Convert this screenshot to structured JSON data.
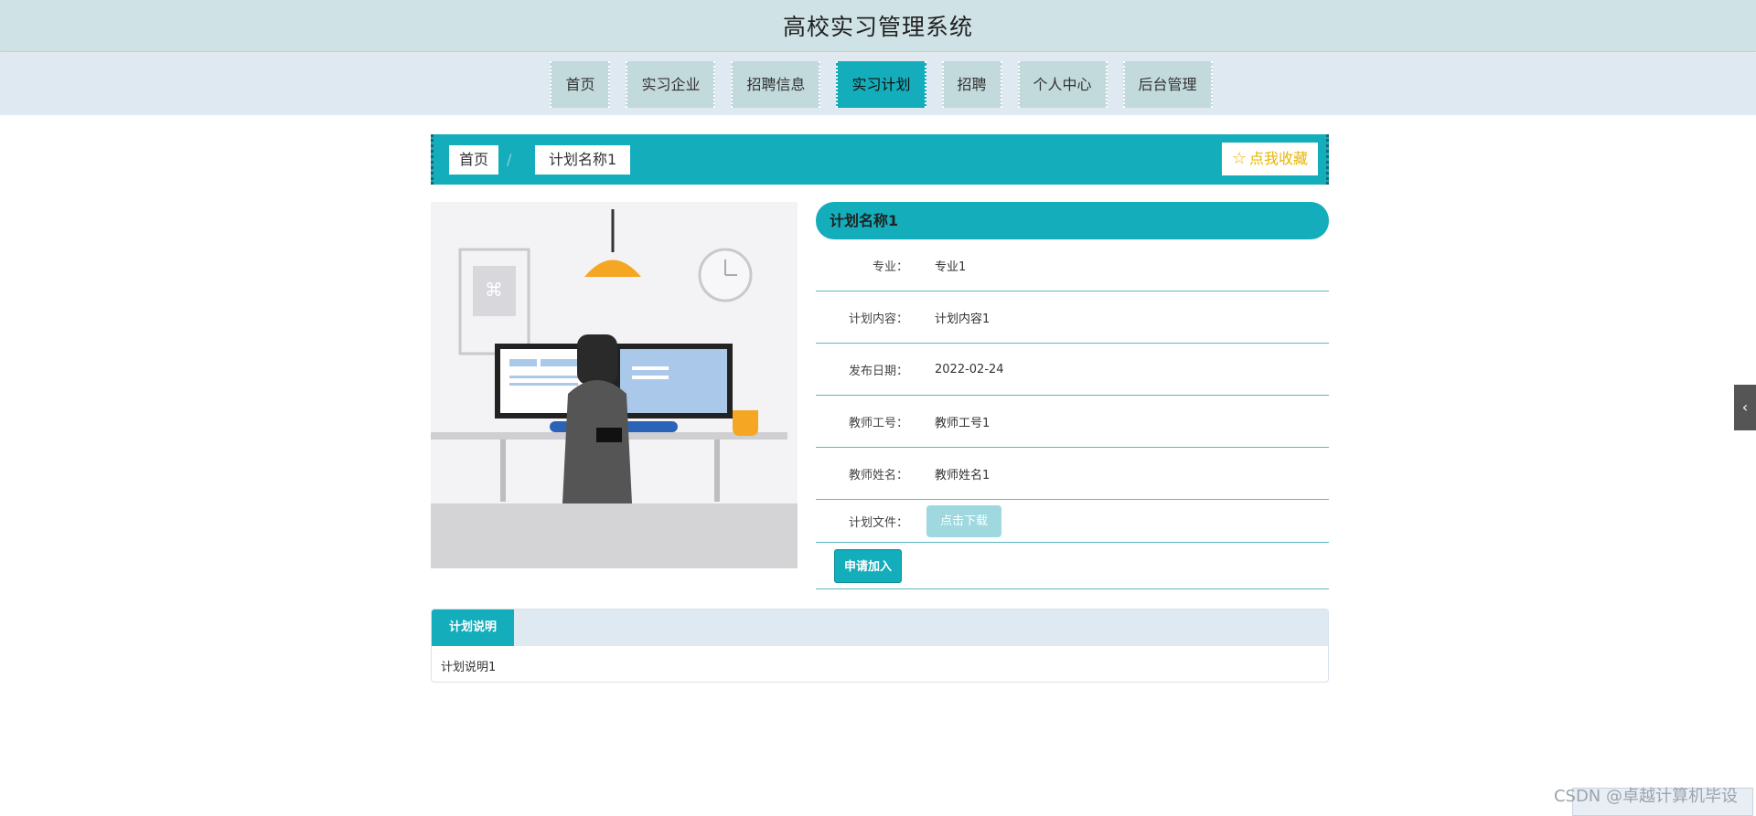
{
  "header": {
    "title": "高校实习管理系统"
  },
  "nav": {
    "items": [
      {
        "label": "首页",
        "active": false
      },
      {
        "label": "实习企业",
        "active": false
      },
      {
        "label": "招聘信息",
        "active": false
      },
      {
        "label": "实习计划",
        "active": true
      },
      {
        "label": "招聘",
        "active": false
      },
      {
        "label": "个人中心",
        "active": false
      },
      {
        "label": "后台管理",
        "active": false
      }
    ]
  },
  "breadcrumb": {
    "home": "首页",
    "separator": "/",
    "current": "计划名称1",
    "favorite_label": "点我收藏",
    "favorite_icon": "star-icon"
  },
  "detail": {
    "title": "计划名称1",
    "fields": [
      {
        "label": "专业：",
        "value": "专业1"
      },
      {
        "label": "计划内容：",
        "value": "计划内容1"
      },
      {
        "label": "发布日期：",
        "value": "2022-02-24"
      },
      {
        "label": "教师工号：",
        "value": "教师工号1"
      },
      {
        "label": "教师姓名：",
        "value": "教师姓名1"
      }
    ],
    "file_label": "计划文件：",
    "download_label": "点击下载",
    "apply_label": "申请加入"
  },
  "description": {
    "tab_label": "计划说明",
    "content": "计划说明1"
  },
  "side_toggle_icon": "chevron-left-icon",
  "watermark": "CSDN @卓越计算机毕设",
  "colors": {
    "accent": "#13adbb",
    "topbar": "#cfe3e7",
    "navbar": "#dfe9f2",
    "nav_item": "#c3dadc",
    "favorite": "#e8b500"
  }
}
